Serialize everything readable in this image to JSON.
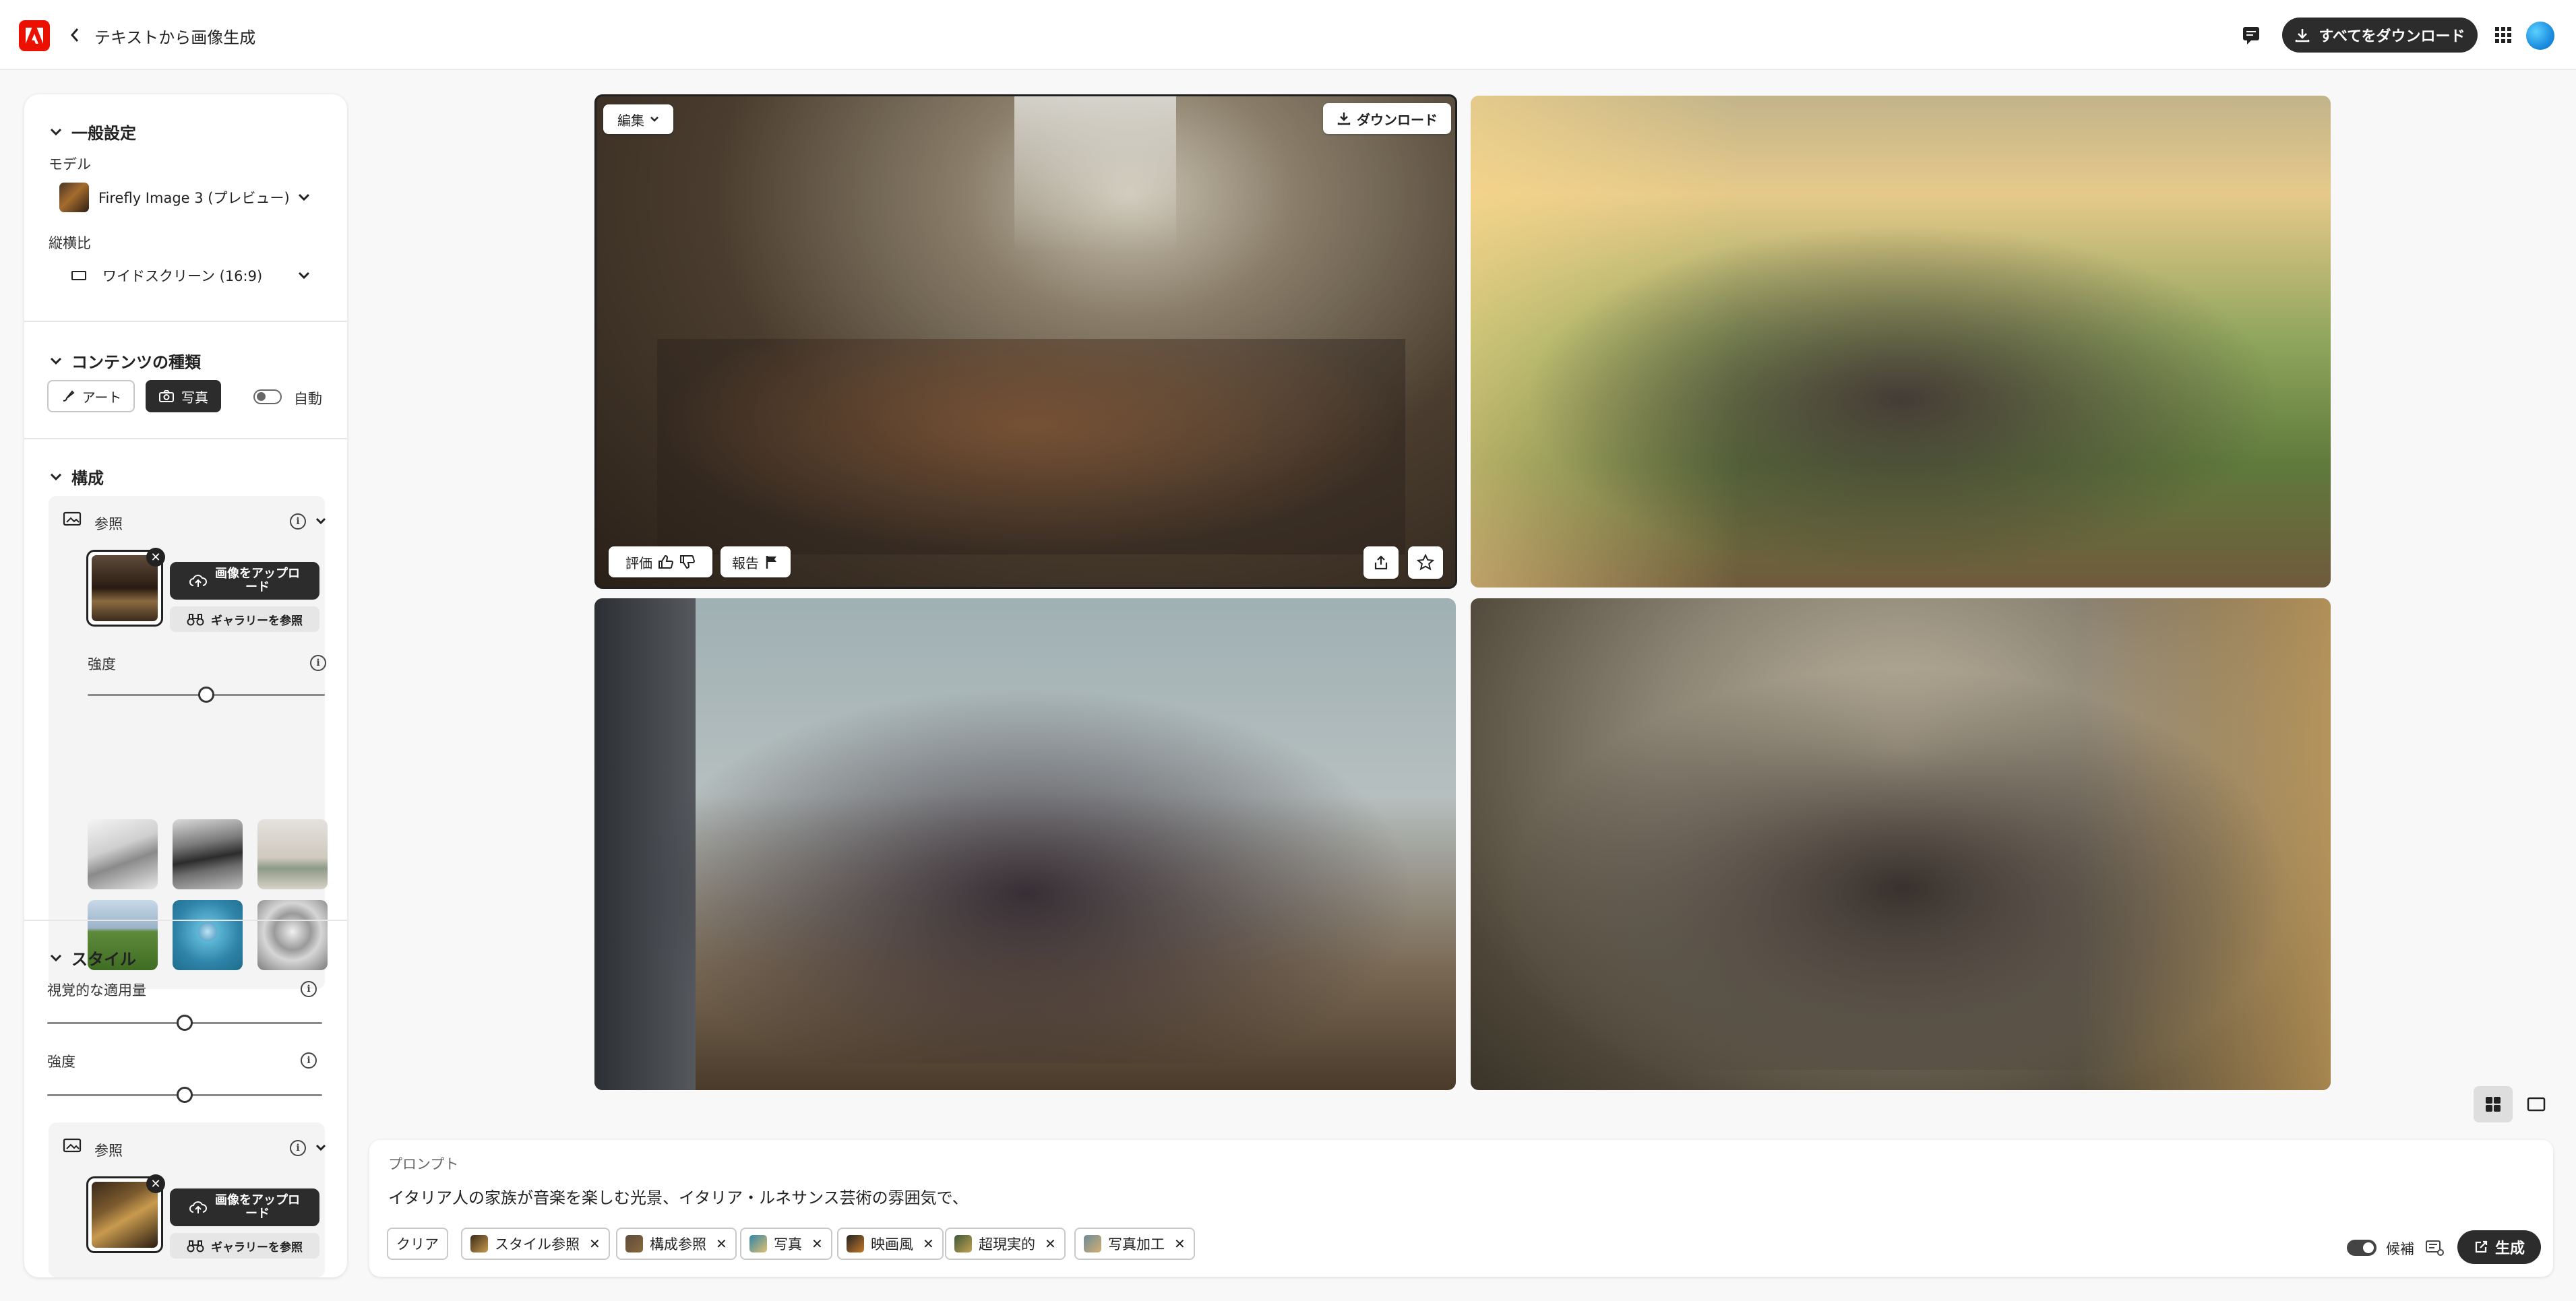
{
  "header": {
    "title": "テキストから画像生成",
    "download_all": "すべてをダウンロード"
  },
  "settings": {
    "general": {
      "heading": "一般設定",
      "model_label": "モデル",
      "model_value": "Firefly Image 3 (プレビュー)",
      "aspect_label": "縦横比",
      "aspect_value": "ワイドスクリーン (16:9)"
    },
    "content_type": {
      "heading": "コンテンツの種類",
      "art": "アート",
      "photo": "写真",
      "auto": "自動",
      "selected": "写真"
    },
    "composition": {
      "heading": "構成",
      "reference_label": "参照",
      "upload": "画像をアップロード",
      "gallery": "ギャラリーを参照",
      "strength_label": "強度",
      "strength_value": 0.5
    },
    "style": {
      "heading": "スタイル",
      "visual_intensity_label": "視覚的な適用量",
      "visual_intensity_value": 0.5,
      "strength_label": "強度",
      "strength_value": 0.5,
      "reference_label": "参照",
      "upload": "画像をアップロード",
      "gallery": "ギャラリーを参照"
    }
  },
  "results": {
    "edit": "編集",
    "download": "ダウンロード",
    "rate": "評価",
    "report": "報告"
  },
  "prompt": {
    "label": "プロンプト",
    "text": "イタリア人の家族が音楽を楽しむ光景、イタリア・ルネサンス芸術の雰囲気で、",
    "clear": "クリア",
    "chips": [
      "スタイル参照",
      "構成参照",
      "写真",
      "映画風",
      "超現実的",
      "写真加工"
    ],
    "suggest": "候補",
    "generate": "生成"
  },
  "colors": {
    "accent": "#eb1000",
    "dark": "#2c2c2c"
  }
}
